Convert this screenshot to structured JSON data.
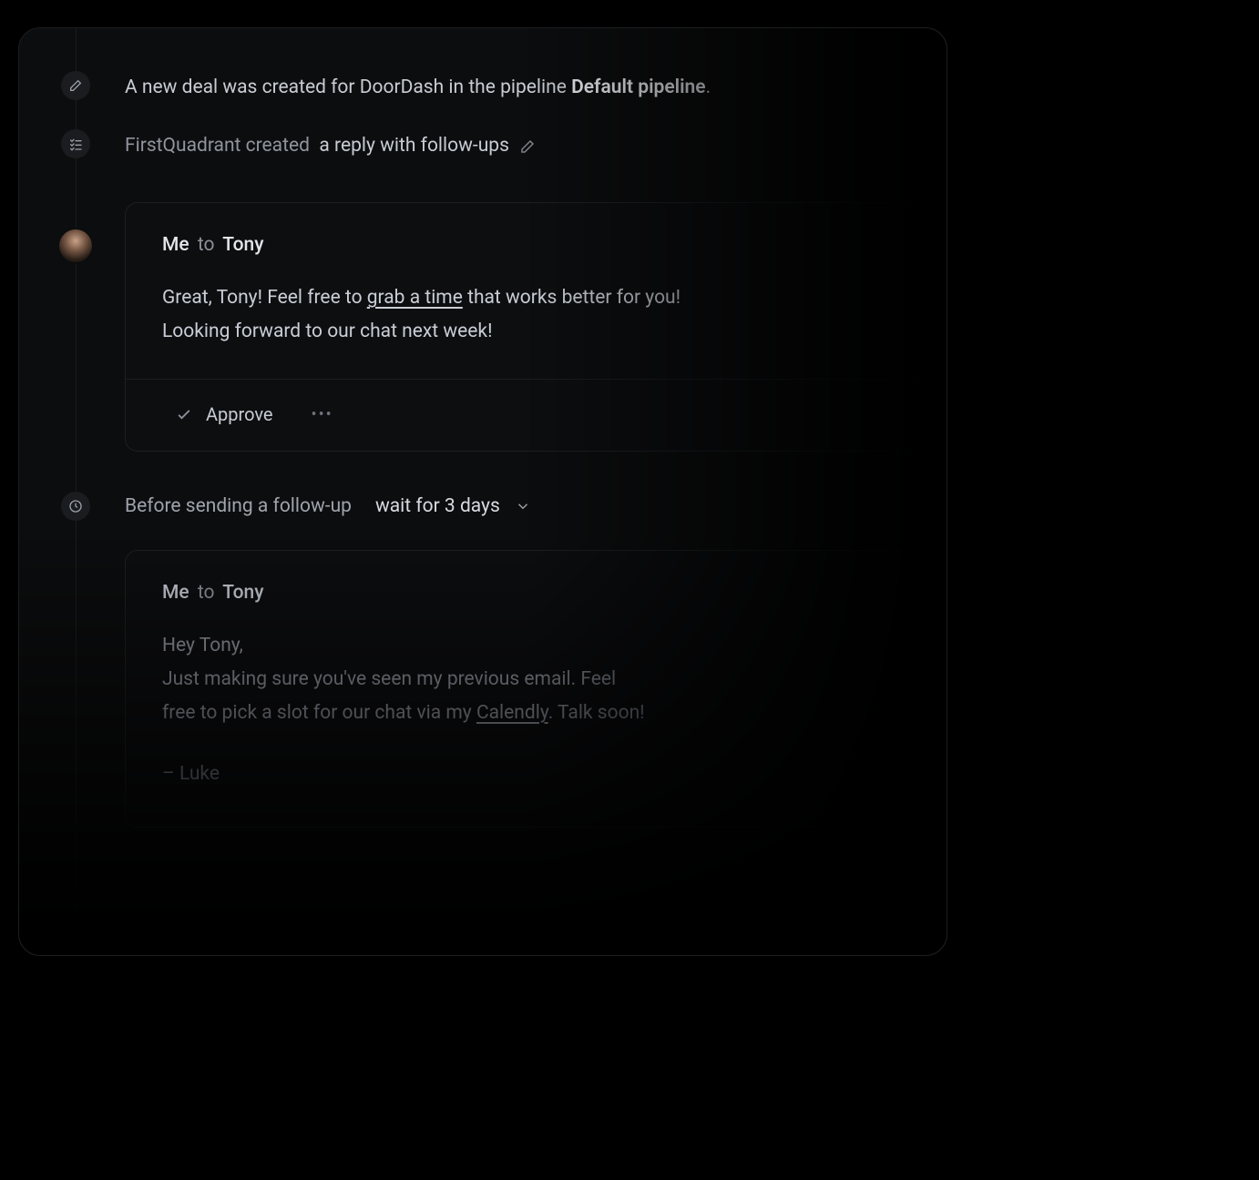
{
  "events": {
    "deal": {
      "prefix": "A new deal was created for DoorDash in the pipeline ",
      "pipeline": "Default pipeline",
      "suffix": "."
    },
    "reply": {
      "actor": "FirstQuadrant created",
      "object": "a reply with follow-ups"
    }
  },
  "message1": {
    "from": "Me",
    "to_label": "to",
    "to": "Tony",
    "line1_a": "Great, Tony! Feel free to ",
    "line1_link": "grab a time",
    "line1_b": " that works better for you!",
    "line2": "Looking forward to our chat next week!",
    "approve": "Approve"
  },
  "wait": {
    "label": "Before sending a follow-up",
    "value": "wait for 3 days"
  },
  "message2": {
    "from": "Me",
    "to_label": "to",
    "to": "Tony",
    "line1": "Hey Tony,",
    "line2": "Just making sure you've seen my previous email. Feel",
    "line3_a": "free to pick a slot for our chat via my ",
    "line3_link": "Calendly",
    "line3_b": ". Talk soon!",
    "signature": "– Luke"
  }
}
